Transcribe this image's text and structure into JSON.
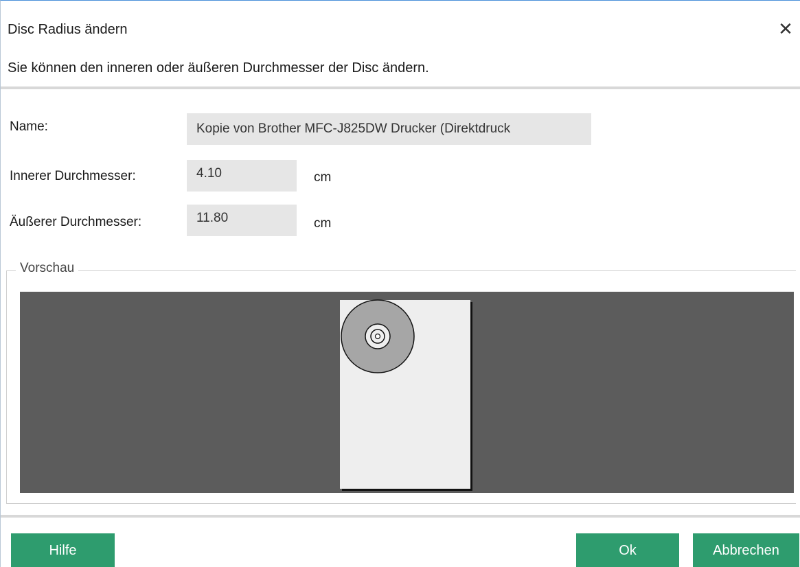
{
  "dialog": {
    "title": "Disc Radius ändern",
    "description": "Sie können den inneren oder äußeren Durchmesser der Disc ändern."
  },
  "form": {
    "name_label": "Name:",
    "name_value": "Kopie von Brother MFC-J825DW Drucker (Direktdruck",
    "inner_label": "Innerer Durchmesser:",
    "inner_value": "4.10",
    "inner_unit": "cm",
    "outer_label": "Äußerer Durchmesser:",
    "outer_value": "11.80",
    "outer_unit": "cm"
  },
  "preview": {
    "label": "Vorschau",
    "background_color": "#5c5c5c",
    "paper_color": "#eeeeee",
    "disc_color": "#a6a6a6"
  },
  "buttons": {
    "help": "Hilfe",
    "ok": "Ok",
    "cancel": "Abbrechen",
    "color": "#2e9c6e"
  },
  "icons": {
    "close": "close-icon"
  }
}
